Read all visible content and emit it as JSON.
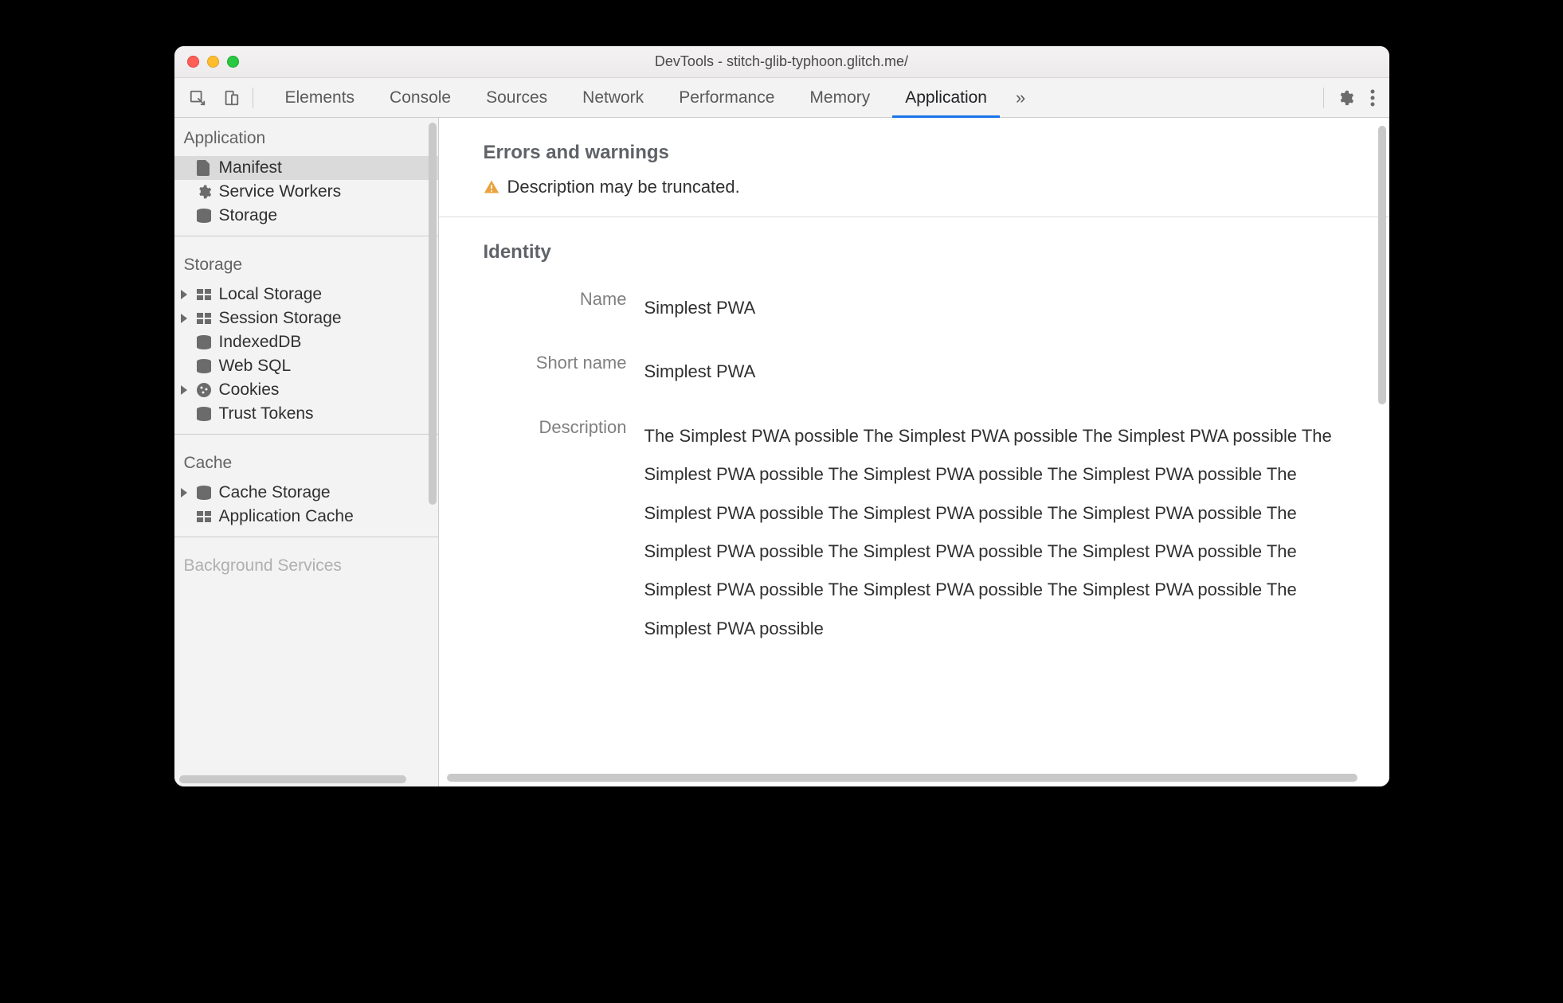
{
  "window": {
    "title": "DevTools - stitch-glib-typhoon.glitch.me/"
  },
  "toolbar": {
    "tabs": [
      "Elements",
      "Console",
      "Sources",
      "Network",
      "Performance",
      "Memory",
      "Application"
    ],
    "active_tab_index": 6
  },
  "sidebar": {
    "groups": [
      {
        "title": "Application",
        "items": [
          {
            "label": "Manifest",
            "icon": "file-icon",
            "selected": true,
            "expandable": false
          },
          {
            "label": "Service Workers",
            "icon": "gear-icon",
            "selected": false,
            "expandable": false
          },
          {
            "label": "Storage",
            "icon": "db-icon",
            "selected": false,
            "expandable": false
          }
        ]
      },
      {
        "title": "Storage",
        "items": [
          {
            "label": "Local Storage",
            "icon": "grid-icon",
            "selected": false,
            "expandable": true
          },
          {
            "label": "Session Storage",
            "icon": "grid-icon",
            "selected": false,
            "expandable": true
          },
          {
            "label": "IndexedDB",
            "icon": "db-icon",
            "selected": false,
            "expandable": false
          },
          {
            "label": "Web SQL",
            "icon": "db-icon",
            "selected": false,
            "expandable": false
          },
          {
            "label": "Cookies",
            "icon": "cookie-icon",
            "selected": false,
            "expandable": true
          },
          {
            "label": "Trust Tokens",
            "icon": "db-icon",
            "selected": false,
            "expandable": false
          }
        ]
      },
      {
        "title": "Cache",
        "items": [
          {
            "label": "Cache Storage",
            "icon": "db-icon",
            "selected": false,
            "expandable": true
          },
          {
            "label": "Application Cache",
            "icon": "grid-icon",
            "selected": false,
            "expandable": false
          }
        ]
      }
    ],
    "faded_group_title": "Background Services"
  },
  "main": {
    "errors_title": "Errors and warnings",
    "warning_text": "Description may be truncated.",
    "identity_title": "Identity",
    "identity": {
      "name_label": "Name",
      "name_value": "Simplest PWA",
      "short_name_label": "Short name",
      "short_name_value": "Simplest PWA",
      "description_label": "Description",
      "description_value": "The Simplest PWA possible The Simplest PWA possible The Simplest PWA possible The Simplest PWA possible The Simplest PWA possible The Simplest PWA possible The Simplest PWA possible The Simplest PWA possible The Simplest PWA possible The Simplest PWA possible The Simplest PWA possible The Simplest PWA possible The Simplest PWA possible The Simplest PWA possible The Simplest PWA possible The Simplest PWA possible"
    }
  }
}
